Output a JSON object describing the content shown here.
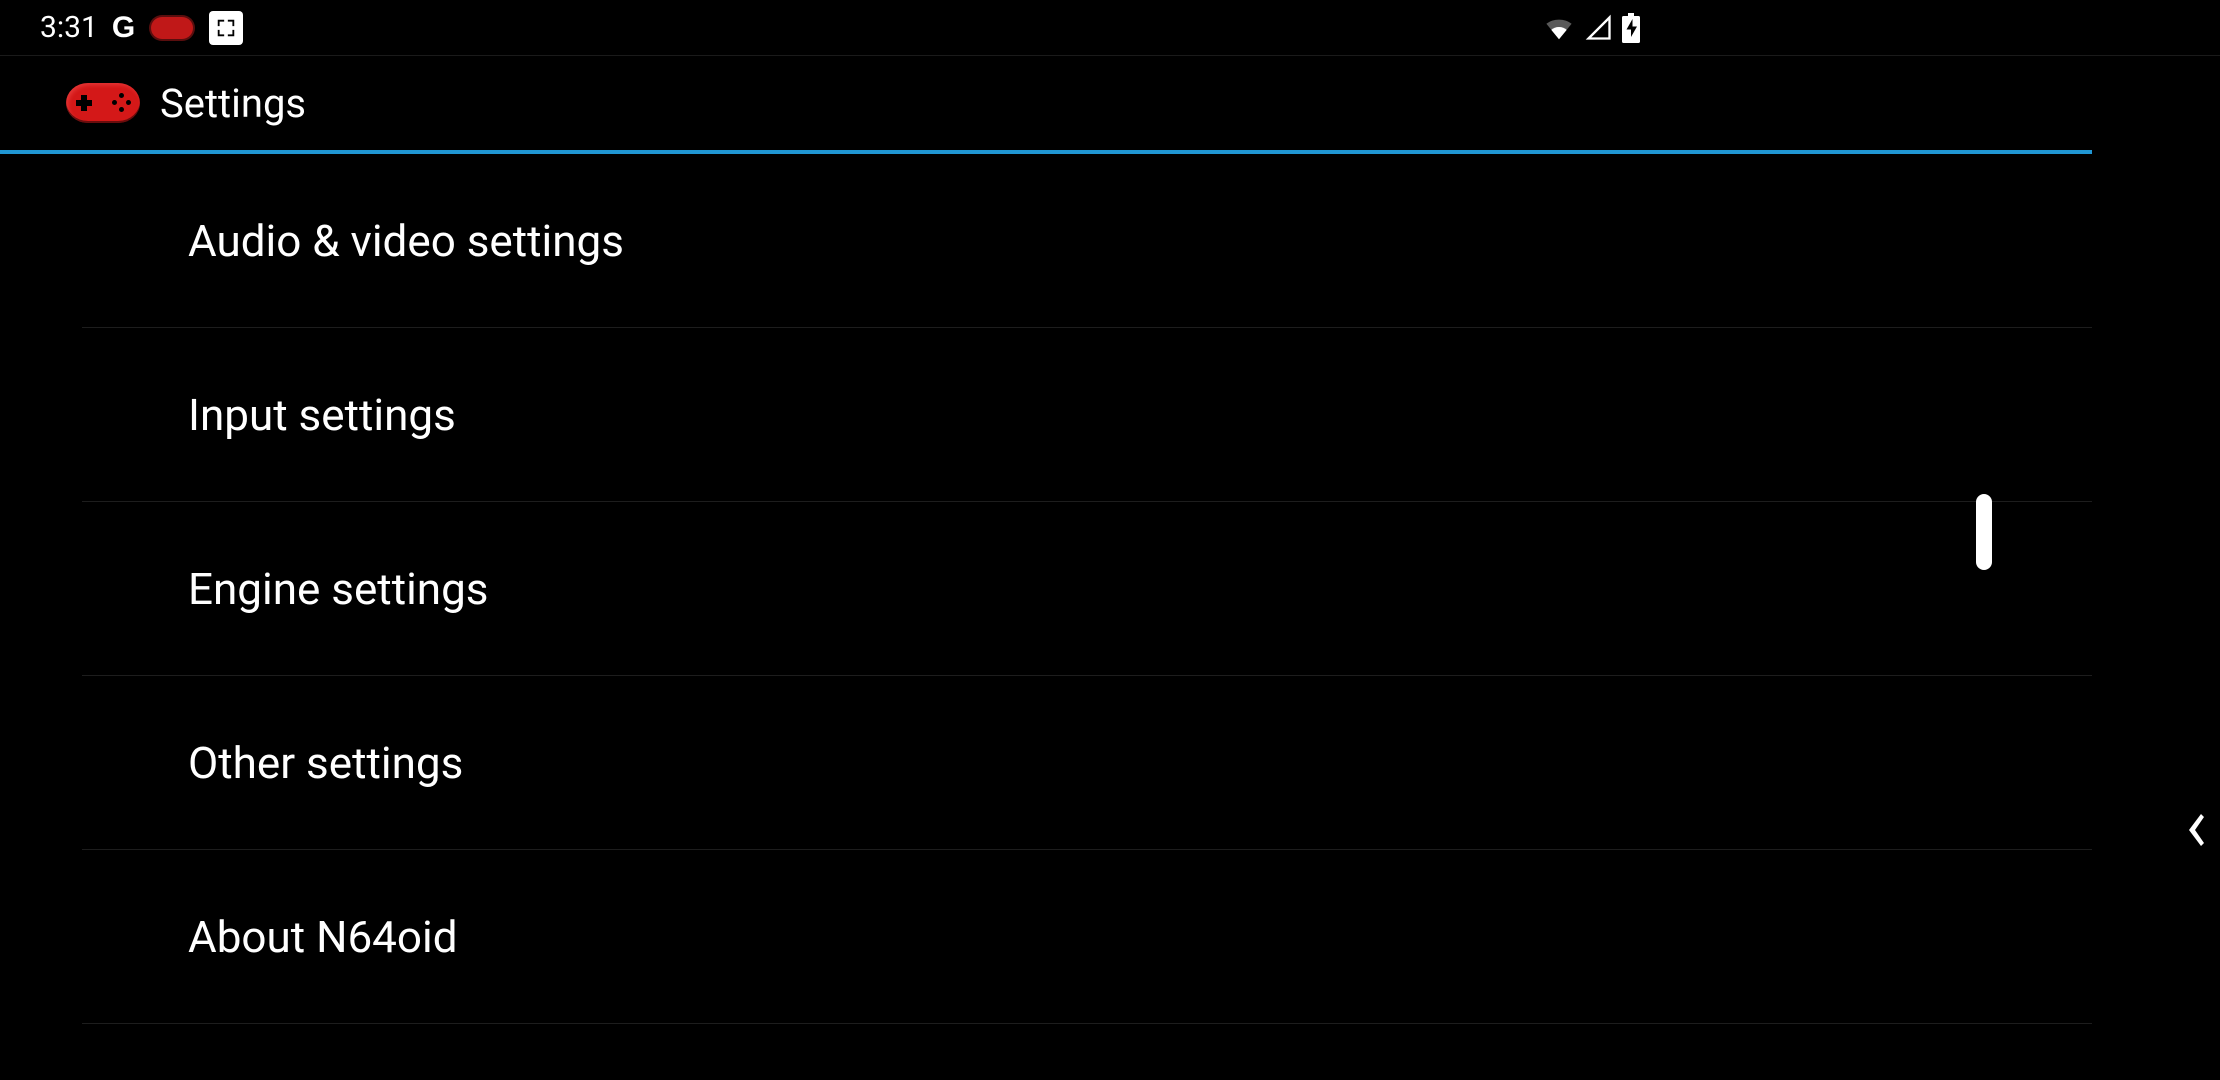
{
  "status_bar": {
    "clock": "3:31",
    "google_icon_label": "G",
    "expand_icon_glyph": "⤢"
  },
  "header": {
    "title": "Settings"
  },
  "settings": {
    "items": [
      {
        "label": "Audio & video settings"
      },
      {
        "label": "Input settings"
      },
      {
        "label": "Engine settings"
      },
      {
        "label": "Other settings"
      },
      {
        "label": "About N64oid"
      }
    ]
  },
  "side_handle_glyph": "‹"
}
